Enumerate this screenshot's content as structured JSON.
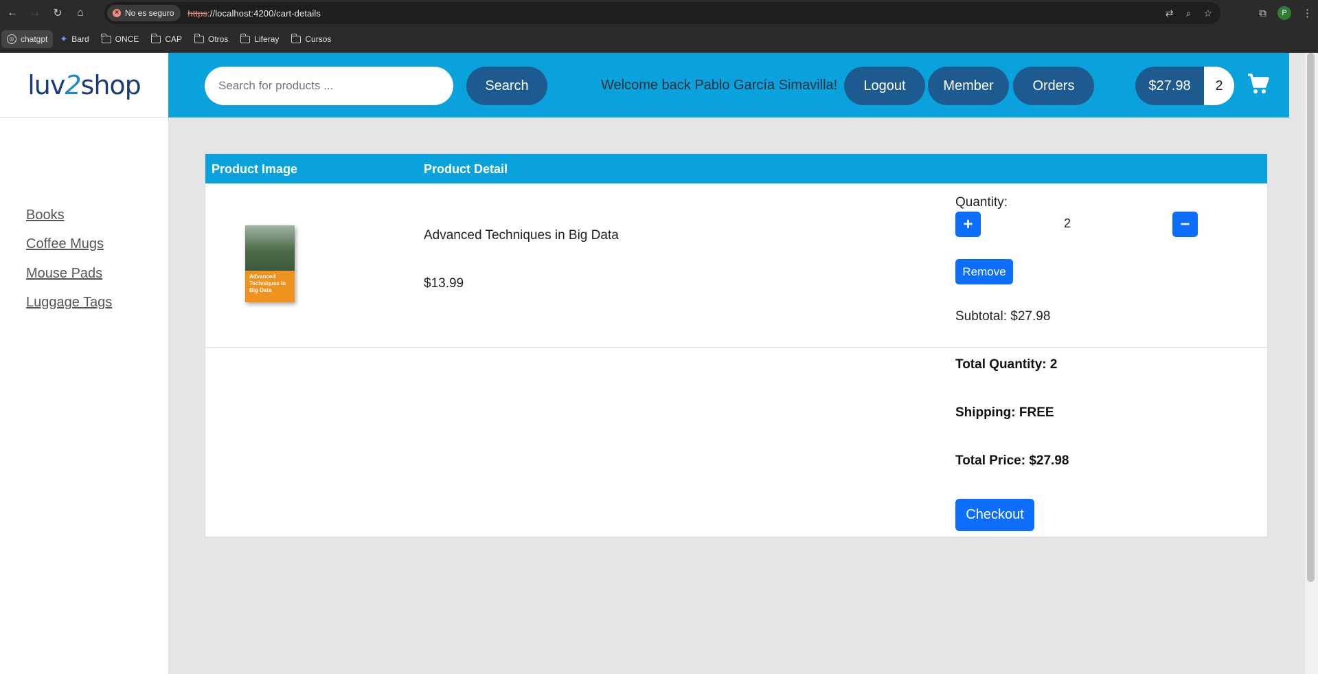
{
  "browser": {
    "security_label": "No es seguro",
    "url_protocol": "https",
    "url_rest": "://localhost:4200/cart-details",
    "profile_initial": "P",
    "bookmarks": [
      {
        "label": "chatgpt",
        "icon": "chatgpt-icon"
      },
      {
        "label": "Bard",
        "icon": "sparkle-icon"
      },
      {
        "label": "ONCE",
        "icon": "folder-icon"
      },
      {
        "label": "CAP",
        "icon": "folder-icon"
      },
      {
        "label": "Otros",
        "icon": "folder-icon"
      },
      {
        "label": "Liferay",
        "icon": "folder-icon"
      },
      {
        "label": "Cursos",
        "icon": "folder-icon"
      }
    ]
  },
  "logo": {
    "part1": "luv",
    "part2": "2",
    "part3": "shop"
  },
  "header": {
    "search_placeholder": "Search for products ...",
    "search_button": "Search",
    "welcome": "Welcome back Pablo García Simavilla!",
    "logout": "Logout",
    "member": "Member",
    "orders": "Orders",
    "cart_total": "$27.98",
    "cart_quantity": "2"
  },
  "sidebar": {
    "categories": [
      "Books",
      "Coffee Mugs",
      "Mouse Pads",
      "Luggage Tags"
    ]
  },
  "cart": {
    "col_image": "Product Image",
    "col_detail": "Product Detail",
    "item": {
      "book_cover_text": "Advanced Techniques in Big Data",
      "name": "Advanced Techniques in Big Data",
      "price": "$13.99",
      "quantity_label": "Quantity:",
      "quantity": "2",
      "plus": "+",
      "minus": "−",
      "remove": "Remove",
      "subtotal": "Subtotal: $27.98"
    },
    "total_quantity": "Total Quantity: 2",
    "shipping": "Shipping: FREE",
    "total_price": "Total Price: $27.98",
    "checkout": "Checkout"
  },
  "colors": {
    "header_bg": "#0aa2dd",
    "pill_bg": "#1d5a8f",
    "primary_button": "#0d6efd"
  }
}
